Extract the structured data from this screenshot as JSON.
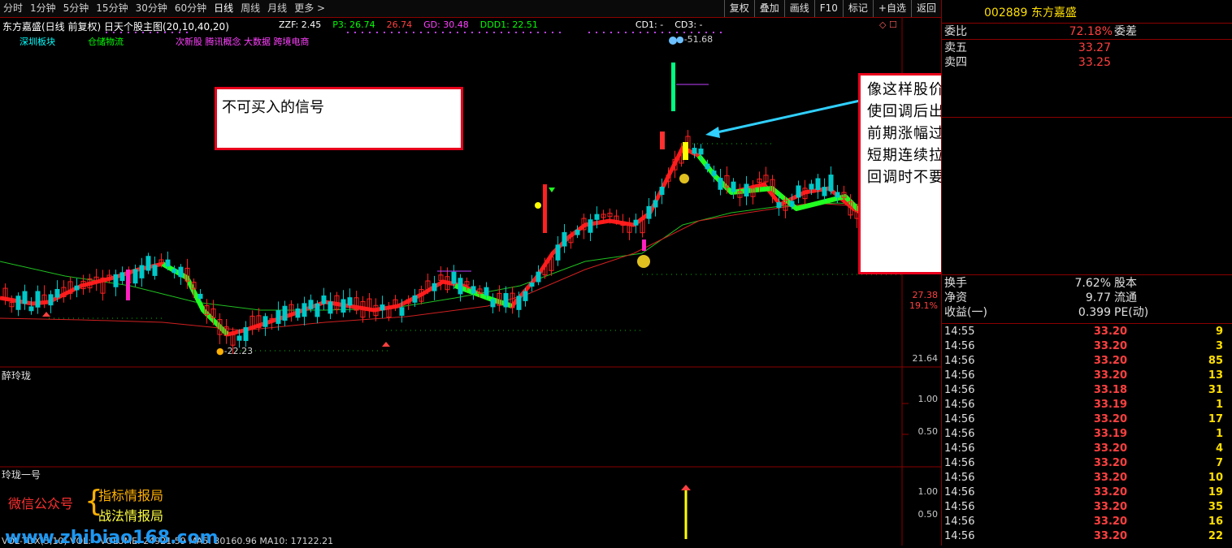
{
  "toolbar": {
    "periods": [
      "分时",
      "1分钟",
      "5分钟",
      "15分钟",
      "30分钟",
      "60分钟",
      "日线",
      "周线",
      "月线",
      "更多 >"
    ],
    "active_period": "日线",
    "right_buttons": [
      "复权",
      "叠加",
      "画线",
      "F10",
      "标记",
      "+自选",
      "返回"
    ]
  },
  "chart": {
    "title": "东方嘉盛(日线 前复权) 日天个股主图(20,10,40,20)",
    "indicators": [
      {
        "text": "ZZF: 2.45",
        "color": "#ffffff"
      },
      {
        "text": "P3: 26.74",
        "color": "#00ff00"
      },
      {
        "text": "26.74",
        "color": "#ff4040"
      },
      {
        "text": "GD: 30.48",
        "color": "#ff40ff"
      },
      {
        "text": "DDD1: 22.51",
        "color": "#00ff00"
      },
      {
        "text": "CD1: -",
        "color": "#ffffff"
      },
      {
        "text": "CD3: -",
        "color": "#ffffff"
      }
    ],
    "tags": [
      {
        "text": "深圳板块",
        "color": "#00ffff"
      },
      {
        "text": "仓储物流",
        "color": "#00ff00"
      },
      {
        "text": "次新股 腾讯概念 大数据 跨境电商",
        "color": "#ff40ff"
      }
    ],
    "high_label": "51.68",
    "low_label": "22.23",
    "y_axis": [
      "27.38",
      "19.1%",
      "21.64"
    ],
    "note_left": "不可买入的信号",
    "note_right": [
      "像这样股价已经翻倍，且短期连拉几个板，即使回调后出予警信号也不要买入！",
      "前期涨幅过大的票，短期回调时不要买入！",
      "短期连续拉板的票，已到了阶段高点，刚开始回调时不要买入！"
    ],
    "sub1_title": "醉玲珑",
    "sub1_y": [
      "1.00",
      "0.50"
    ],
    "sub2_title": "玲珑一号",
    "sub2_y": [
      "1.00",
      "0.50"
    ],
    "wechat_label": "微信公众号",
    "wechat_items": [
      "指标情报局",
      "战法情报局"
    ],
    "volume_line": "VOL-TDX(5,10)  VOL: -  VOLUME: 24921.59  MA5: 30160.96  MA10: 17122.21",
    "watermark": "www.zhibiao168.com"
  },
  "quote": {
    "code": "002889",
    "name": "东方嘉盛",
    "weibi_label": "委比",
    "weibi_value": "72.18%",
    "weicha_label": "委差",
    "asks": [
      {
        "label": "卖五",
        "price": "33.27"
      },
      {
        "label": "卖四",
        "price": "33.25"
      }
    ],
    "stats": [
      {
        "k": "换手",
        "v": "7.62%",
        "k2": "股本"
      },
      {
        "k": "净资",
        "v": "9.77",
        "k2": "流通"
      },
      {
        "k": "收益(一)",
        "v": "0.399",
        "k2": "PE(动)"
      }
    ],
    "ticks": [
      {
        "t": "14:55",
        "p": "33.20",
        "q": "9"
      },
      {
        "t": "14:56",
        "p": "33.20",
        "q": "3"
      },
      {
        "t": "14:56",
        "p": "33.20",
        "q": "85"
      },
      {
        "t": "14:56",
        "p": "33.20",
        "q": "13"
      },
      {
        "t": "14:56",
        "p": "33.18",
        "q": "31"
      },
      {
        "t": "14:56",
        "p": "33.19",
        "q": "1"
      },
      {
        "t": "14:56",
        "p": "33.20",
        "q": "17"
      },
      {
        "t": "14:56",
        "p": "33.19",
        "q": "1"
      },
      {
        "t": "14:56",
        "p": "33.20",
        "q": "4"
      },
      {
        "t": "14:56",
        "p": "33.20",
        "q": "7"
      },
      {
        "t": "14:56",
        "p": "33.20",
        "q": "10"
      },
      {
        "t": "14:56",
        "p": "33.20",
        "q": "19"
      },
      {
        "t": "14:56",
        "p": "33.20",
        "q": "35"
      },
      {
        "t": "14:56",
        "p": "33.20",
        "q": "16"
      },
      {
        "t": "14:56",
        "p": "33.20",
        "q": "22"
      }
    ]
  },
  "colors": {
    "up": "#ff2020",
    "down": "#00d0d0",
    "ma_green": "#00ff00",
    "border": "#8b0000",
    "note_border": "#e8001c",
    "arrow": "#30d0ff"
  }
}
